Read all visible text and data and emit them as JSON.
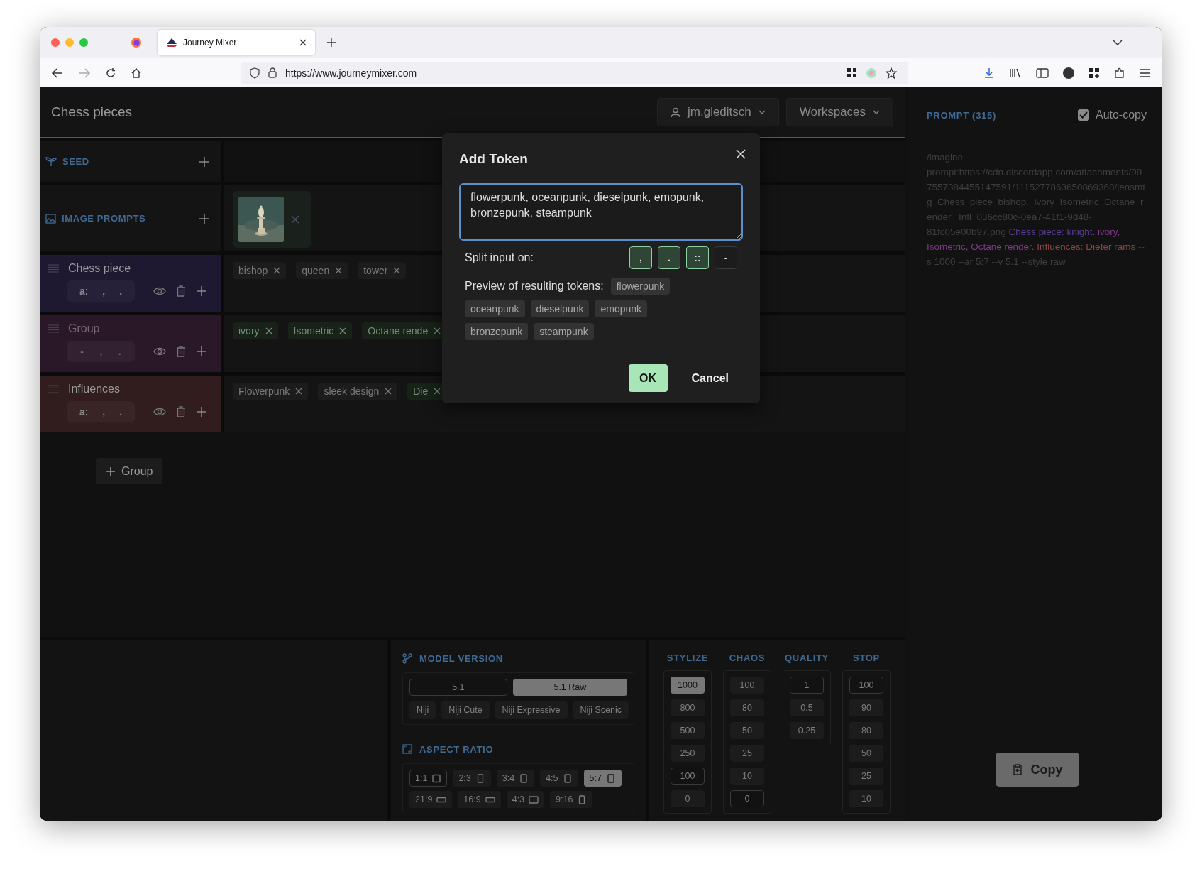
{
  "browser": {
    "tab_title": "Journey Mixer",
    "url": "https://www.journeymixer.com"
  },
  "header": {
    "title": "Chess pieces",
    "user": "jm.gleditsch",
    "workspaces": "Workspaces"
  },
  "sections": [
    {
      "kind": "seed",
      "label": "SEED"
    },
    {
      "kind": "images",
      "label": "IMAGE PROMPTS"
    }
  ],
  "groups": [
    {
      "name": "Chess piece",
      "muted": false,
      "color": "#1e1830",
      "weight": [
        "a:",
        ",",
        "."
      ],
      "tokens": [
        {
          "text": "bishop",
          "color": "#7a7a7a"
        },
        {
          "text": "queen",
          "color": "#7a7a7a"
        },
        {
          "text": "tower",
          "color": "#7a7a7a"
        }
      ]
    },
    {
      "name": "Group",
      "muted": true,
      "color": "#2a1828",
      "weight": [
        "-",
        ",",
        "."
      ],
      "tokens": [
        {
          "text": "ivory",
          "color": "#6f916f"
        },
        {
          "text": "Isometric",
          "color": "#6f916f"
        },
        {
          "text": "Octane rende",
          "color": "#6f916f"
        }
      ]
    },
    {
      "name": "Influences",
      "muted": false,
      "color": "#311c1e",
      "weight": [
        "a:",
        ",",
        "."
      ],
      "tokens": [
        {
          "text": "Flowerpunk",
          "color": "#7a7a7a"
        },
        {
          "text": "sleek design",
          "color": "#7a7a7a"
        },
        {
          "text": "Die",
          "color": "#6f916f"
        }
      ]
    }
  ],
  "add_group": "Group",
  "modal": {
    "title": "Add Token",
    "value": "flowerpunk, oceanpunk, dieselpunk, emopunk, bronzepunk, steampunk",
    "split_label": "Split input on:",
    "split_options": [
      {
        "label": ",",
        "selected": true
      },
      {
        "label": ".",
        "selected": true
      },
      {
        "label": "::",
        "selected": true
      },
      {
        "label": "-",
        "selected": false
      }
    ],
    "preview_label": "Preview of resulting tokens:",
    "preview_tokens": [
      "flowerpunk",
      "oceanpunk",
      "dieselpunk",
      "emopunk",
      "bronzepunk",
      "steampunk"
    ],
    "ok": "OK",
    "cancel": "Cancel"
  },
  "model_version": {
    "label": "MODEL VERSION",
    "versions": [
      {
        "label": "5.1",
        "selected": false,
        "default": true
      },
      {
        "label": "5.1 Raw",
        "selected": true,
        "default": false
      }
    ],
    "niji": [
      {
        "label": "Niji",
        "selected": false,
        "default": false
      },
      {
        "label": "Niji Cute",
        "selected": false,
        "default": false
      },
      {
        "label": "Niji Expressive",
        "selected": false,
        "default": false
      },
      {
        "label": "Niji Scenic",
        "selected": false,
        "default": false
      }
    ]
  },
  "aspect_ratio": {
    "label": "ASPECT RATIO",
    "options": [
      {
        "label": "1:1",
        "kind": "square",
        "selected": false,
        "default": true
      },
      {
        "label": "2:3",
        "kind": "tall",
        "selected": false,
        "default": false
      },
      {
        "label": "3:4",
        "kind": "portrait",
        "selected": false,
        "default": false
      },
      {
        "label": "4:5",
        "kind": "portrait",
        "selected": false,
        "default": false
      },
      {
        "label": "5:7",
        "kind": "portrait",
        "selected": true,
        "default": false
      },
      {
        "label": "21:9",
        "kind": "wide",
        "selected": false,
        "default": false
      },
      {
        "label": "16:9",
        "kind": "wide",
        "selected": false,
        "default": false
      },
      {
        "label": "4:3",
        "kind": "landscape",
        "selected": false,
        "default": false
      },
      {
        "label": "9:16",
        "kind": "tall",
        "selected": false,
        "default": false
      }
    ]
  },
  "params": [
    {
      "label": "STYLIZE",
      "options": [
        {
          "label": "1000",
          "selected": true,
          "default": false
        },
        {
          "label": "800",
          "selected": false,
          "default": false
        },
        {
          "label": "500",
          "selected": false,
          "default": false
        },
        {
          "label": "250",
          "selected": false,
          "default": false
        },
        {
          "label": "100",
          "selected": false,
          "default": true
        },
        {
          "label": "0",
          "selected": false,
          "default": false
        }
      ]
    },
    {
      "label": "CHAOS",
      "options": [
        {
          "label": "100",
          "selected": false,
          "default": false
        },
        {
          "label": "80",
          "selected": false,
          "default": false
        },
        {
          "label": "50",
          "selected": false,
          "default": false
        },
        {
          "label": "25",
          "selected": false,
          "default": false
        },
        {
          "label": "10",
          "selected": false,
          "default": false
        },
        {
          "label": "0",
          "selected": false,
          "default": true
        }
      ]
    },
    {
      "label": "QUALITY",
      "options": [
        {
          "label": "1",
          "selected": false,
          "default": true
        },
        {
          "label": "0.5",
          "selected": false,
          "default": false
        },
        {
          "label": "0.25",
          "selected": false,
          "default": false
        }
      ]
    },
    {
      "label": "STOP",
      "options": [
        {
          "label": "100",
          "selected": false,
          "default": true
        },
        {
          "label": "90",
          "selected": false,
          "default": false
        },
        {
          "label": "80",
          "selected": false,
          "default": false
        },
        {
          "label": "50",
          "selected": false,
          "default": false
        },
        {
          "label": "25",
          "selected": false,
          "default": false
        },
        {
          "label": "10",
          "selected": false,
          "default": false
        }
      ]
    }
  ],
  "prompt": {
    "label": "PROMPT (315)",
    "auto_copy": {
      "label": "Auto-copy",
      "checked": true
    },
    "segments": [
      {
        "text": "/imagine prompt:https://cdn.discordapp.com/attachments/997557384455147591/1115277863650869368/jensmtg_Chess_piece_bishop._ivory_Isometric_Octane_render._Infl_036cc80c-0ea7-41f1-9d48-81fc05e00b97.png ",
        "color": "#3e3e3e"
      },
      {
        "text": "Chess piece: knight.",
        "color": "#5b3e96"
      },
      {
        "text": " ivory, Isometric, Octane render.",
        "color": "#7d3a86"
      },
      {
        "text": " Influences: Dieter rams",
        "color": "#8a4844"
      },
      {
        "text": " --s 1000 --ar 5:7 --v 5.1 --style raw",
        "color": "#3e3e3e"
      }
    ],
    "copy": "Copy"
  }
}
